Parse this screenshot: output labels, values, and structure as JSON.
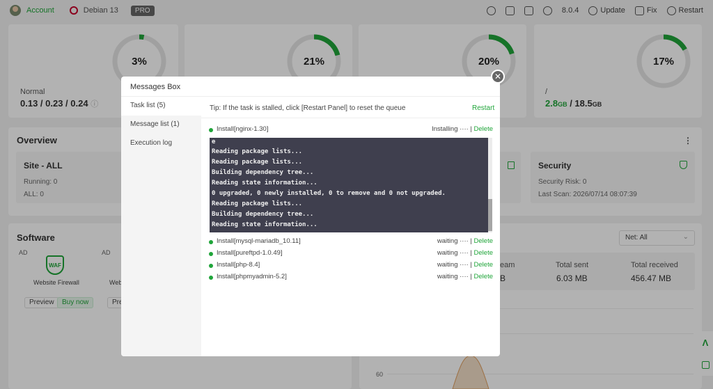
{
  "topbar": {
    "account": "Account",
    "os": "Debian 13",
    "pro": "PRO",
    "version": "8.0.4",
    "update": "Update",
    "fix": "Fix",
    "restart": "Restart"
  },
  "stats": [
    {
      "value": "3%",
      "percent": 3,
      "label": "Normal",
      "detail": "0.13 / 0.23 / 0.24"
    },
    {
      "value": "21%",
      "percent": 21
    },
    {
      "value": "20%",
      "percent": 20
    },
    {
      "value": "17%",
      "percent": 17,
      "label": "/",
      "used": "2.8",
      "used_unit": "GB",
      "sep": " / ",
      "total": "18.5",
      "total_unit": "GB"
    }
  ],
  "overview": {
    "title": "Overview",
    "site": {
      "title": "Site - ALL",
      "running": "Running: 0",
      "all": "ALL: 0"
    },
    "security": {
      "title": "Security",
      "risk": "Security Risk: 0",
      "last_scan": "Last Scan: 2026/07/14 08:07:39"
    }
  },
  "software": {
    "title": "Software",
    "ad1": "AD",
    "ad2": "AD",
    "waf_badge": "WAF",
    "app_name": "Website Firewall",
    "app_name2": "Web",
    "preview": "Preview",
    "buy": "Buy now",
    "preview2": "Prev"
  },
  "traffic": {
    "net_select": "Net: All",
    "stream_frag": "eam",
    "stream_val": "B",
    "sent_label": "Total sent",
    "sent_value": "6.03 MB",
    "recv_label": "Total received",
    "recv_value": "456.47 MB",
    "axis_60": "60"
  },
  "modal": {
    "title": "Messages Box",
    "tabs": [
      "Task list (5)",
      "Message list (1)",
      "Execution log"
    ],
    "tip": "Tip: If the task is stalled, click [Restart Panel] to reset the queue",
    "restart": "Restart",
    "current_task": {
      "name": "Install[nginx-1.30]",
      "status": "Installing ···· | ",
      "action": "Delete"
    },
    "console_lines": [
      "e",
      "Reading package lists...",
      "Reading package lists...",
      "Building dependency tree...",
      "Reading state information...",
      "0 upgraded, 0 newly installed, 0 to remove and 0 not upgraded.",
      "Reading package lists...",
      "Building dependency tree...",
      "Reading state information..."
    ],
    "queued_tasks": [
      {
        "name": "Install[mysql-mariadb_10.11]",
        "status": "waiting ···· | ",
        "action": "Delete"
      },
      {
        "name": "Install[pureftpd-1.0.49]",
        "status": "waiting ···· | ",
        "action": "Delete"
      },
      {
        "name": "Install[php-8.4]",
        "status": "waiting ···· | ",
        "action": "Delete"
      },
      {
        "name": "Install[phpmyadmin-5.2]",
        "status": "waiting ···· | ",
        "action": "Delete"
      }
    ]
  },
  "colors": {
    "accent": "#20a53a",
    "console_bg": "#3f3f4e"
  }
}
